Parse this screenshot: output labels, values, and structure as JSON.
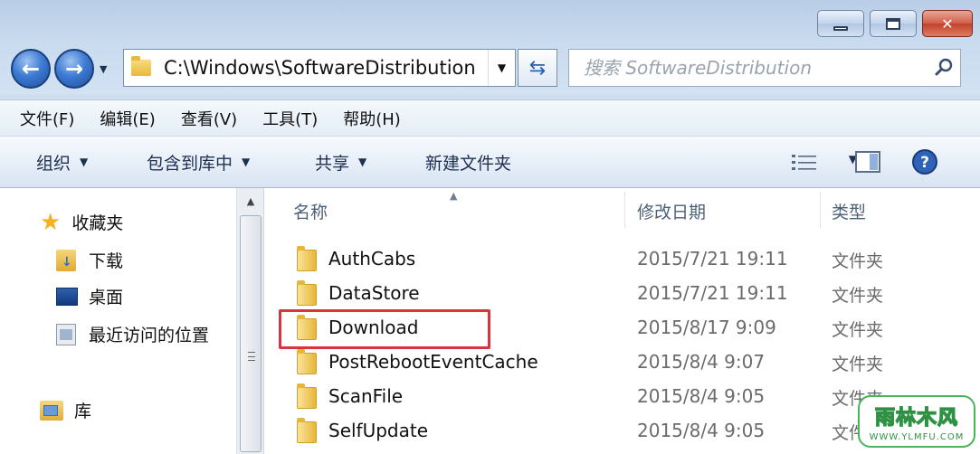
{
  "window": {
    "caption_buttons": {
      "minimize": "minimize",
      "maximize": "maximize",
      "close": "✕"
    }
  },
  "toolbar": {
    "address": "C:\\Windows\\SoftwareDistribution",
    "search_placeholder": "搜索 SoftwareDistribution"
  },
  "menu": [
    "文件(F)",
    "编辑(E)",
    "查看(V)",
    "工具(T)",
    "帮助(H)"
  ],
  "commands": {
    "organize": "组织",
    "include_in_library": "包含到库中",
    "share": "共享",
    "new_folder": "新建文件夹"
  },
  "nav_pane": {
    "favorites": "收藏夹",
    "downloads": "下载",
    "desktop": "桌面",
    "recent": "最近访问的位置",
    "libraries": "库"
  },
  "columns": {
    "name": "名称",
    "modified": "修改日期",
    "type": "类型"
  },
  "files": [
    {
      "name": "AuthCabs",
      "modified": "2015/7/21 19:11",
      "type": "文件夹"
    },
    {
      "name": "DataStore",
      "modified": "2015/7/21 19:11",
      "type": "文件夹"
    },
    {
      "name": "Download",
      "modified": "2015/8/17 9:09",
      "type": "文件夹"
    },
    {
      "name": "PostRebootEventCache",
      "modified": "2015/8/4 9:07",
      "type": "文件夹"
    },
    {
      "name": "ScanFile",
      "modified": "2015/8/4 9:05",
      "type": "文件夹"
    },
    {
      "name": "SelfUpdate",
      "modified": "2015/8/4 9:05",
      "type": "文件夹"
    }
  ],
  "watermark": {
    "main": "雨林木风",
    "sub": "WWW.YLMFU.COM"
  },
  "colors": {
    "highlight": "#d9333d",
    "accent": "#2f6fcf"
  }
}
